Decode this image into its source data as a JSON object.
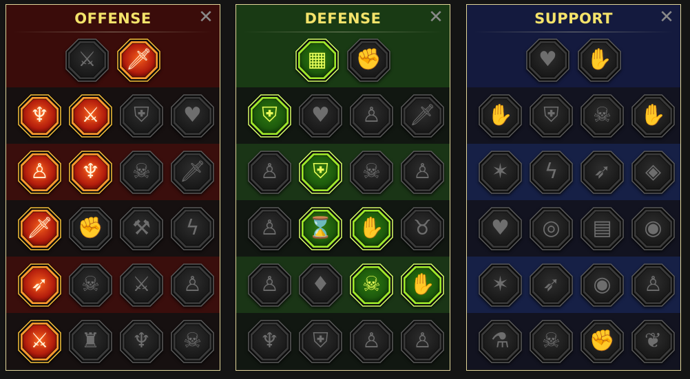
{
  "panels": [
    {
      "id": "offense",
      "title": "OFFENSE",
      "close_icon": "close-x-icon",
      "accent": "#e94a1e",
      "top": [
        {
          "icon": "crossed-swords-icon",
          "active": false
        },
        {
          "icon": "slashing-blade-icon",
          "active": true
        }
      ],
      "rows": [
        [
          {
            "icon": "horned-demon-icon",
            "active": true
          },
          {
            "icon": "flaming-sword-icon",
            "active": true
          },
          {
            "icon": "shield-crack-icon",
            "active": false
          },
          {
            "icon": "bleeding-heart-icon",
            "active": false
          }
        ],
        [
          {
            "icon": "pierced-figure-icon",
            "active": true
          },
          {
            "icon": "fanged-maw-icon",
            "active": true
          },
          {
            "icon": "skull-strike-icon",
            "active": false
          },
          {
            "icon": "reaper-scythe-icon",
            "active": false
          }
        ],
        [
          {
            "icon": "dripping-dagger-icon",
            "active": true
          },
          {
            "icon": "fist-hammer-icon",
            "active": false
          },
          {
            "icon": "axe-strike-icon",
            "active": false
          },
          {
            "icon": "lightning-chain-icon",
            "active": false
          }
        ],
        [
          {
            "icon": "arrow-barrage-icon",
            "active": true
          },
          {
            "icon": "mouse-skull-icon",
            "active": false
          },
          {
            "icon": "sword-orbit-icon",
            "active": false
          },
          {
            "icon": "raging-warrior-icon",
            "active": false
          }
        ],
        [
          {
            "icon": "sparkling-sword-icon",
            "active": true
          },
          {
            "icon": "knight-helm-icon",
            "active": false
          },
          {
            "icon": "demon-beast-icon",
            "active": false
          },
          {
            "icon": "crowned-skull-icon",
            "active": false
          }
        ]
      ]
    },
    {
      "id": "defense",
      "title": "DEFENSE",
      "close_icon": "close-x-icon",
      "accent": "#8fe51e",
      "top": [
        {
          "icon": "armor-plates-icon",
          "active": true
        },
        {
          "icon": "raised-fist-icon",
          "active": false
        }
      ],
      "rows": [
        [
          {
            "icon": "chevron-shield-icon",
            "active": true
          },
          {
            "icon": "stone-heart-icon",
            "active": false
          },
          {
            "icon": "armored-body-icon",
            "active": false
          },
          {
            "icon": "broken-blade-icon",
            "active": false
          }
        ],
        [
          {
            "icon": "dodging-figure-icon",
            "active": false
          },
          {
            "icon": "shield-knight-icon",
            "active": true
          },
          {
            "icon": "skull-heart-icon",
            "active": false
          },
          {
            "icon": "hooded-guardian-icon",
            "active": false
          }
        ],
        [
          {
            "icon": "crowd-figures-icon",
            "active": false
          },
          {
            "icon": "hourglass-burst-icon",
            "active": true
          },
          {
            "icon": "flame-hand-icon",
            "active": true
          },
          {
            "icon": "bull-head-icon",
            "active": false
          }
        ],
        [
          {
            "icon": "dashing-runner-icon",
            "active": false
          },
          {
            "icon": "triple-drops-icon",
            "active": false
          },
          {
            "icon": "radiant-skull-icon",
            "active": true
          },
          {
            "icon": "grabbing-hand-icon",
            "active": true
          }
        ],
        [
          {
            "icon": "wild-beast-icon",
            "active": false
          },
          {
            "icon": "winged-shield-icon",
            "active": false
          },
          {
            "icon": "bearded-head-icon",
            "active": false
          },
          {
            "icon": "muscle-flex-icon",
            "active": false
          }
        ]
      ]
    },
    {
      "id": "support",
      "title": "SUPPORT",
      "close_icon": "close-x-icon",
      "accent": "#f4e36a",
      "top": [
        {
          "icon": "heart-plus-icon",
          "active": false
        },
        {
          "icon": "spiral-hand-icon",
          "active": false
        }
      ],
      "rows": [
        [
          {
            "icon": "praying-hands-icon",
            "active": false
          },
          {
            "icon": "shield-aura-icon",
            "active": false
          },
          {
            "icon": "smoke-skull-icon",
            "active": false
          },
          {
            "icon": "hand-stream-icon",
            "active": false
          }
        ],
        [
          {
            "icon": "sparkle-figure-icon",
            "active": false
          },
          {
            "icon": "lightning-bolt-icon",
            "active": false
          },
          {
            "icon": "zigzag-arrows-icon",
            "active": false
          },
          {
            "icon": "shadow-double-icon",
            "active": false
          }
        ],
        [
          {
            "icon": "chained-heart-icon",
            "active": false
          },
          {
            "icon": "comet-orb-icon",
            "active": false
          },
          {
            "icon": "open-book-icon",
            "active": false
          },
          {
            "icon": "angry-eyes-icon",
            "active": false
          }
        ],
        [
          {
            "icon": "compass-star-icon",
            "active": false
          },
          {
            "icon": "swift-boot-icon",
            "active": false
          },
          {
            "icon": "all-seeing-eye-icon",
            "active": false
          },
          {
            "icon": "juggler-figure-icon",
            "active": false
          }
        ],
        [
          {
            "icon": "potion-flask-icon",
            "active": false
          },
          {
            "icon": "horned-skull-icon",
            "active": false
          },
          {
            "icon": "rising-fist-icon",
            "active": false
          },
          {
            "icon": "eagle-head-icon",
            "active": false
          }
        ]
      ]
    }
  ]
}
